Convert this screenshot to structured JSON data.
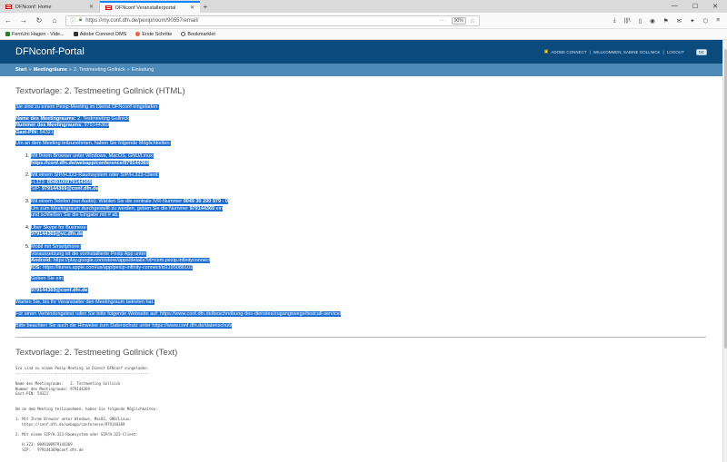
{
  "tabs": [
    {
      "title": "DFNconf: Home",
      "active": false
    },
    {
      "title": "DFNconf Veranstalterportal",
      "active": true
    }
  ],
  "window_controls": [
    "—",
    "☐",
    "✕"
  ],
  "address_bar": {
    "url": "https://my.conf.dfn.de/pexip/room/90557/email/",
    "zoom": "90%"
  },
  "bookmarks": [
    {
      "label": "FernUni Hagen - Vide...",
      "color": "#2f7d32"
    },
    {
      "label": "Adobe Connect DMS",
      "color": "#333333"
    },
    {
      "label": "Erste Schritte",
      "color": "#e8643c"
    },
    {
      "label": "Bookmarklet",
      "color": "#555555"
    }
  ],
  "portal": {
    "title": "DFNconf-Portal",
    "adobe_connect": "ADOBE CONNECT",
    "welcome": "WILLKOMMEN, SABINE GOLLNICK",
    "logout": "LOGOUT",
    "lang": "DE"
  },
  "breadcrumb": {
    "start": "Start",
    "meetingraeume": "Meetingräume",
    "room": "2. Testmeeting Gollnick",
    "page": "Einladung"
  },
  "html_template": {
    "heading": "Textvorlage: 2. Testmeeting Gollnick (HTML)",
    "intro": "Sie sind zu einem Pexip-Meeting im Dienst DFNconf eingeladen:",
    "name_label": "Name des Meetingraums:",
    "name_value": "2. Testmeeting Gollnick",
    "number_label": "Nummer des Meetingraums:",
    "number_value": "979144369",
    "pin_label": "Gast-PIN:",
    "pin_value": "54321",
    "options_intro": "Um an dem Meeting teilzunehmen, haben Sie folgende Möglichkeiten:",
    "opt1_line1": "Mit Ihrem Browser unter Windows, MacOS, GNU/Linux:",
    "opt1_link": "https://conf.dfn.de/webapp/conference/979144369",
    "opt2_line1": "Mit einem SIP/H.323-Raumsystem oder SIP/H.323-Client:",
    "opt2_h323_label": "H.323:",
    "opt2_h323_value": "0049100979144369",
    "opt2_sip_label": "SIP:",
    "opt2_sip_value": "979144369@conf.dfn.de",
    "opt3_line1_a": "Mit einem Telefon (nur Audio): Wählen Sie die zentrale IVR-Nummer",
    "opt3_phone": "0049 30 200 979 - 0",
    "opt3_line2_a": "Um zum Meetingraum durchgestellt zu werden, geben Sie die Nummer",
    "opt3_line2_num": "979144369",
    "opt3_line2_b": "ein",
    "opt3_line3": "und schließen Sie die Eingabe mit # ab.",
    "opt4_line1": "Über Skype for Business:",
    "opt4_value": "979144369@vc.dfn.de",
    "opt5_line1": "Mobil mit Smartphone:",
    "opt5_line2": "Voraussetzung ist die vorinstallierte Pexip App unter",
    "opt5_android_label": "Android:",
    "opt5_android_url": "https://play.google.com/store/apps/details?id=com.pexip.infinityconnect",
    "opt5_ios_label": "IOS:",
    "opt5_ios_url": "https://itunes.apple.com/us/app/pexip-infinity-connect/id1195088102",
    "opt5_enter": "Geben Sie ein:",
    "opt5_value": "979144369@conf.dfn.de",
    "wait": "Warten Sie, bis Ihr Veranstalter den Meetingraum betreten hat.",
    "test": "Für einen Verbindungstest rufen Sie bitte folgende Webseite auf: https://www.conf.dfn.de/beschreibung-des-dienstes/zugangswege/testcall-service/",
    "privacy": "Bitte beachten Sie auch die Hinweise zum Datenschutz unter https://www.conf.dfn.de/datenschutz"
  },
  "text_template": {
    "heading": "Textvorlage: 2. Testmeeting Gollnick (Text)",
    "lines": [
      "Sie sind zu einem Pexip-Meeting im Dienst DFNconf eingeladen:",
      "-------------------------------------------------------------",
      "",
      "Name des Meetingraums:   2. Testmeeting Gollnick",
      "Nummer des Meetingraums: 979144369",
      "Gast-PIN: 54321",
      "",
      "",
      "Um an dem Meeting teilzunehmen, haben Sie folgende Möglichkeiten:",
      "",
      "1. Mit Ihrem Browser unter Windows, MacOS, GNU/Linux:",
      "   https://conf.dfn.de/webapp/conference/979144369",
      "",
      "2. Mit einem SIP/H.323-Raumsystem oder SIP/H.323-Client:",
      "",
      "   H.323: 0049100979144369",
      "   SIP:   979144369@conf.dfn.de"
    ]
  }
}
